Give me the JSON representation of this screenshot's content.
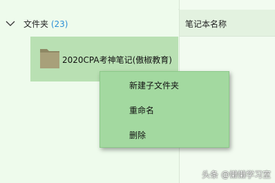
{
  "tree": {
    "folder_label": "文件夹",
    "folder_count": "(23)",
    "selected_item": "2020CPA考神笔记(傲椒教育)"
  },
  "list": {
    "column_header": "笔记本名称"
  },
  "context_menu": {
    "items": [
      {
        "label": "新建子文件夹"
      },
      {
        "label": "重命名"
      },
      {
        "label": "删除"
      }
    ]
  },
  "watermark": "头条 @懒懒学习室",
  "colors": {
    "background": "#eefbec",
    "selection": "#b9e0b3",
    "menu": "#a3d9a0",
    "count_accent": "#2b8fd6",
    "folder": "#a8a07a"
  },
  "icons": {
    "expand": "chevron-down-icon",
    "folder": "folder-icon"
  }
}
